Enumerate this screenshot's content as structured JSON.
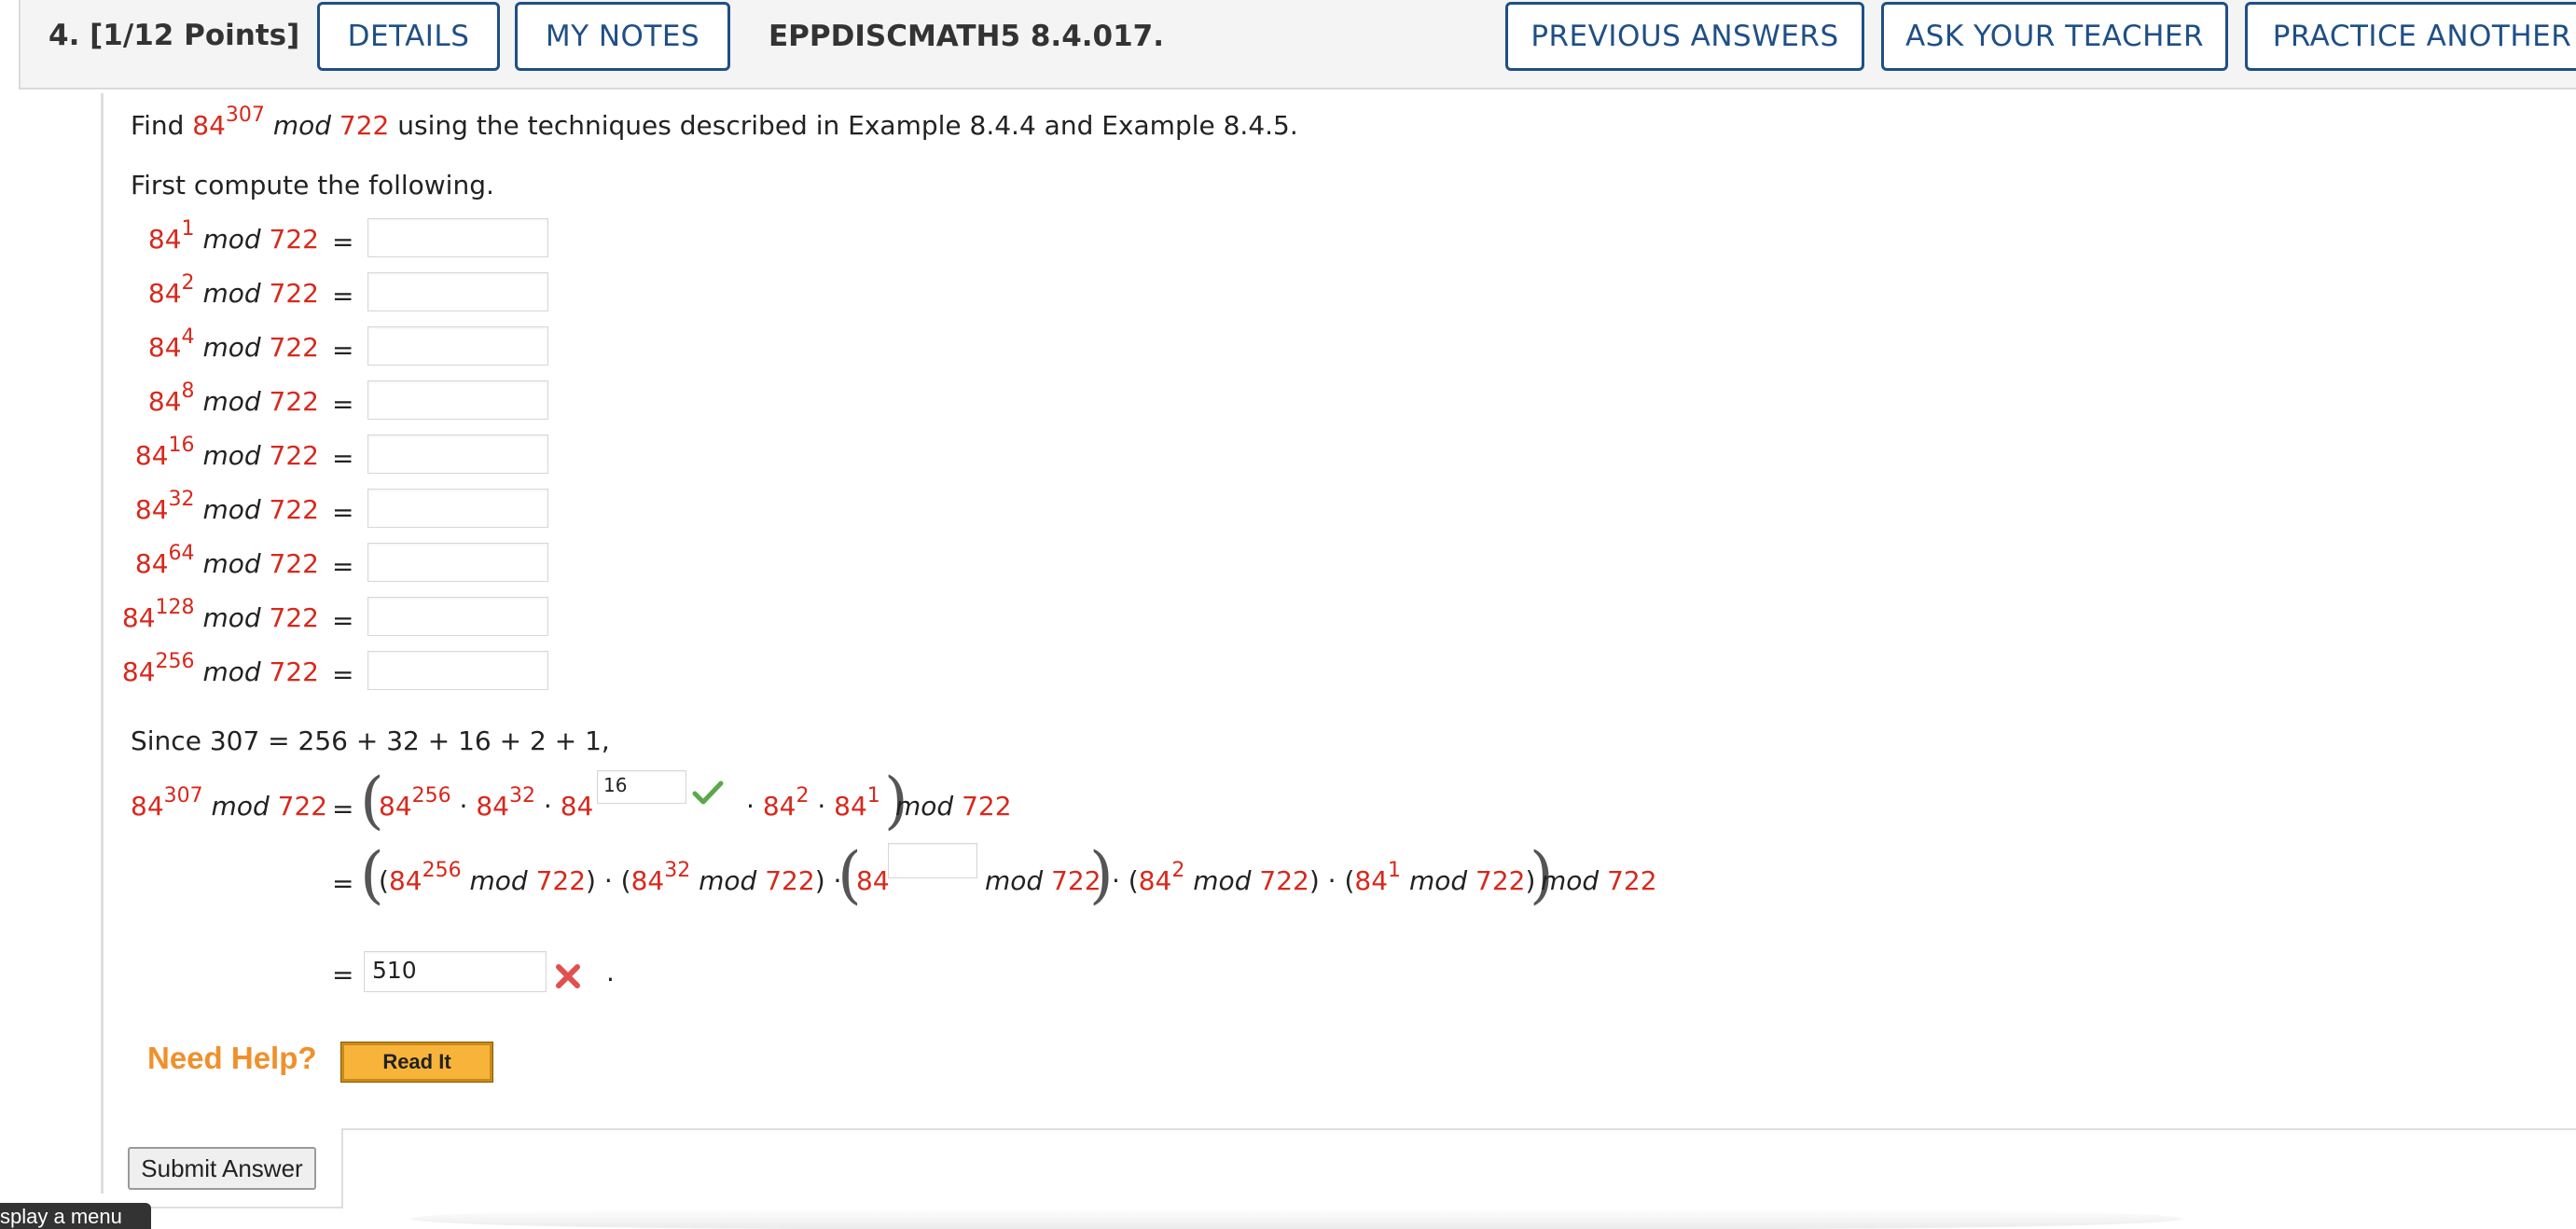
{
  "header": {
    "question_number": "4.  [1/12 Points]",
    "details": "DETAILS",
    "my_notes": "MY NOTES",
    "code": "EPPDISCMATH5 8.4.017.",
    "previous_answers": "PREVIOUS ANSWERS",
    "ask_teacher": "ASK YOUR TEACHER",
    "practice_another": "PRACTICE ANOTHER"
  },
  "problem": {
    "find_word": "Find",
    "base": "84",
    "exponent": "307",
    "mod_word": "mod",
    "modulus": "722",
    "instruction_rest": "using the techniques described in Example 8.4.4 and Example 8.4.5.",
    "first_compute": "First compute the following."
  },
  "powers": [
    {
      "exp": "1",
      "answer": ""
    },
    {
      "exp": "2",
      "answer": ""
    },
    {
      "exp": "4",
      "answer": ""
    },
    {
      "exp": "8",
      "answer": ""
    },
    {
      "exp": "16",
      "answer": ""
    },
    {
      "exp": "32",
      "answer": ""
    },
    {
      "exp": "64",
      "answer": ""
    },
    {
      "exp": "128",
      "answer": ""
    },
    {
      "exp": "256",
      "answer": ""
    }
  ],
  "since_line": "Since 307 = 256 + 32 + 16 + 2 + 1,",
  "product": {
    "exp_a": "256",
    "exp_b": "32",
    "blank_exp_value": "16",
    "exp_d": "2",
    "exp_e": "1",
    "second_row_blank_value": "",
    "final_answer": "510",
    "final_status": "incorrect",
    "first_blank_status": "correct"
  },
  "help": {
    "need_help": "Need Help?",
    "read_it": "Read It"
  },
  "submit_label": "Submit Answer",
  "menu_tab": "splay a menu",
  "colors": {
    "accent_blue": "#1f4f86",
    "math_red": "#d8281c",
    "help_orange": "#f0902a",
    "check_green": "#5aa84a",
    "cross_red": "#e05050"
  }
}
